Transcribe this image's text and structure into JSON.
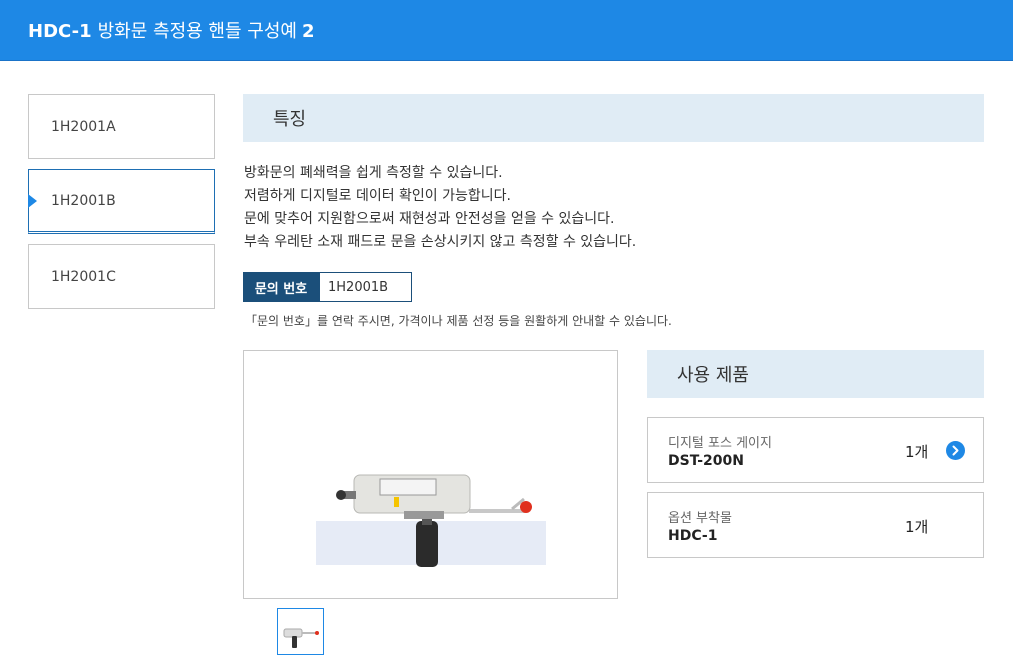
{
  "header": {
    "code": "HDC-1",
    "title": "방화문 측정용 핸들 구성예",
    "number": "2"
  },
  "sidebar": {
    "items": [
      {
        "label": "1H2001A"
      },
      {
        "label": "1H2001B"
      },
      {
        "label": "1H2001C"
      }
    ],
    "active_index": 1
  },
  "features": {
    "heading": "특징",
    "lines": [
      "방화문의 폐쇄력을 쉽게 측정할 수 있습니다.",
      "저렴하게 디지털로 데이터 확인이 가능합니다.",
      "문에 맞추어 지원함으로써 재현성과 안전성을 얻을 수 있습니다.",
      "부속 우레탄 소재 패드로 문을 손상시키지 않고 측정할 수 있습니다."
    ]
  },
  "inquiry": {
    "label": "문의 번호",
    "value": "1H2001B",
    "note": "「문의 번호」를 연락 주시면, 가격이나 제품 선정 등을 원활하게 안내할 수 있습니다."
  },
  "products": {
    "heading": "사용 제품",
    "items": [
      {
        "category": "디지털 포스 게이지",
        "model": "DST-200N",
        "qty": "1개"
      },
      {
        "category": "옵션 부착물",
        "model": "HDC-1",
        "qty": "1개"
      }
    ]
  },
  "colors": {
    "brand": "#1e88e5",
    "section_bg": "#e0ecf5",
    "label_bg": "#1b4f7a"
  },
  "icons": {
    "product_link": "chevron-right-circle-icon"
  }
}
